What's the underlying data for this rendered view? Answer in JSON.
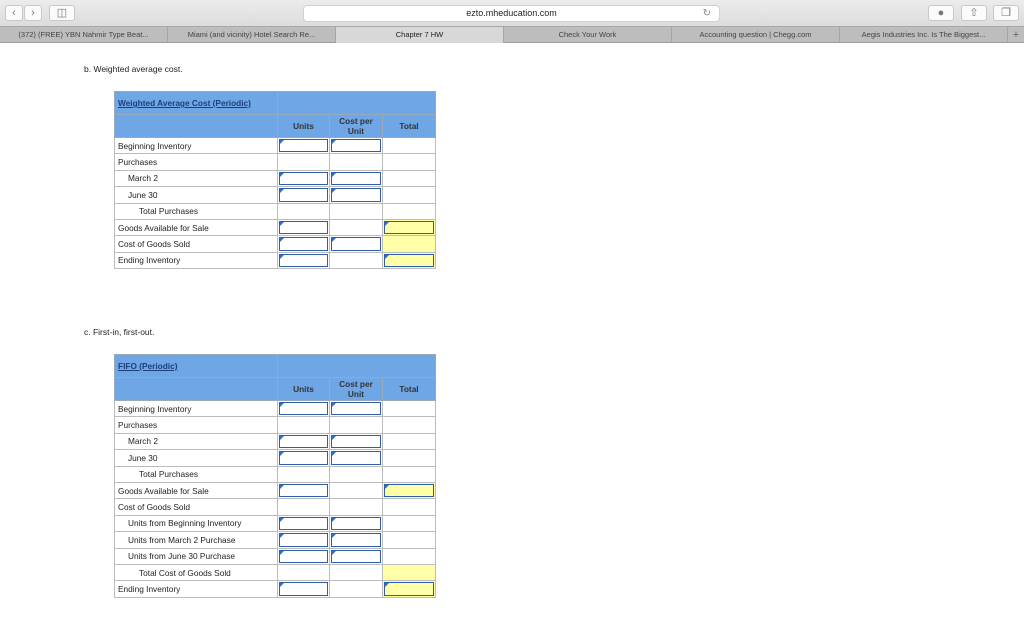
{
  "browser": {
    "url": "ezto.mheducation.com",
    "tabs": [
      {
        "label": "(372) (FREE) YBN Nahmir Type Beat..."
      },
      {
        "label": "Miami (and vicinity) Hotel Search Re..."
      },
      {
        "label": "Chapter 7 HW",
        "active": true
      },
      {
        "label": "Check Your Work"
      },
      {
        "label": "Accounting question | Chegg.com"
      },
      {
        "label": "Aegis Industries Inc. Is The Biggest..."
      }
    ]
  },
  "sections": [
    {
      "heading": "b. Weighted average cost.",
      "title": "Weighted Average Cost (Periodic)",
      "col_units": "Units",
      "col_cost": "Cost per Unit",
      "col_total": "Total",
      "rows": [
        {
          "label": "Beginning Inventory",
          "indent": 0,
          "units": true,
          "cost": true,
          "total": "none"
        },
        {
          "label": "Purchases",
          "indent": 0,
          "units": false,
          "cost": false,
          "total": "none"
        },
        {
          "label": "March 2",
          "indent": 1,
          "units": true,
          "cost": true,
          "total": "none"
        },
        {
          "label": "June 30",
          "indent": 1,
          "units": true,
          "cost": true,
          "total": "none"
        },
        {
          "label": "Total Purchases",
          "indent": 2,
          "units": false,
          "cost": false,
          "total": "none"
        },
        {
          "label": "Goods Available for Sale",
          "indent": 0,
          "units": true,
          "cost": false,
          "total": "input"
        },
        {
          "label": "Cost of Goods Sold",
          "indent": 0,
          "units": true,
          "cost": true,
          "total": "yellow"
        },
        {
          "label": "Ending Inventory",
          "indent": 0,
          "units": true,
          "cost": false,
          "total": "input"
        }
      ]
    },
    {
      "heading": "c. First-in, first-out.",
      "title": "FIFO (Periodic)",
      "col_units": "Units",
      "col_cost": "Cost per Unit",
      "col_total": "Total",
      "rows": [
        {
          "label": "Beginning Inventory",
          "indent": 0,
          "units": true,
          "cost": true,
          "total": "none"
        },
        {
          "label": "Purchases",
          "indent": 0,
          "units": false,
          "cost": false,
          "total": "none"
        },
        {
          "label": "March 2",
          "indent": 1,
          "units": true,
          "cost": true,
          "total": "none"
        },
        {
          "label": "June 30",
          "indent": 1,
          "units": true,
          "cost": true,
          "total": "none"
        },
        {
          "label": "Total Purchases",
          "indent": 2,
          "units": false,
          "cost": false,
          "total": "none"
        },
        {
          "label": "Goods Available for Sale",
          "indent": 0,
          "units": true,
          "cost": false,
          "total": "input"
        },
        {
          "label": "Cost of Goods Sold",
          "indent": 0,
          "units": false,
          "cost": false,
          "total": "none"
        },
        {
          "label": "Units from Beginning Inventory",
          "indent": 1,
          "units": true,
          "cost": true,
          "total": "none"
        },
        {
          "label": "Units from March 2 Purchase",
          "indent": 1,
          "units": true,
          "cost": true,
          "total": "none"
        },
        {
          "label": "Units from June 30 Purchase",
          "indent": 1,
          "units": true,
          "cost": true,
          "total": "none"
        },
        {
          "label": "Total Cost of Goods Sold",
          "indent": 2,
          "units": false,
          "cost": false,
          "total": "yellow"
        },
        {
          "label": "Ending Inventory",
          "indent": 0,
          "units": true,
          "cost": false,
          "total": "input"
        }
      ]
    }
  ]
}
